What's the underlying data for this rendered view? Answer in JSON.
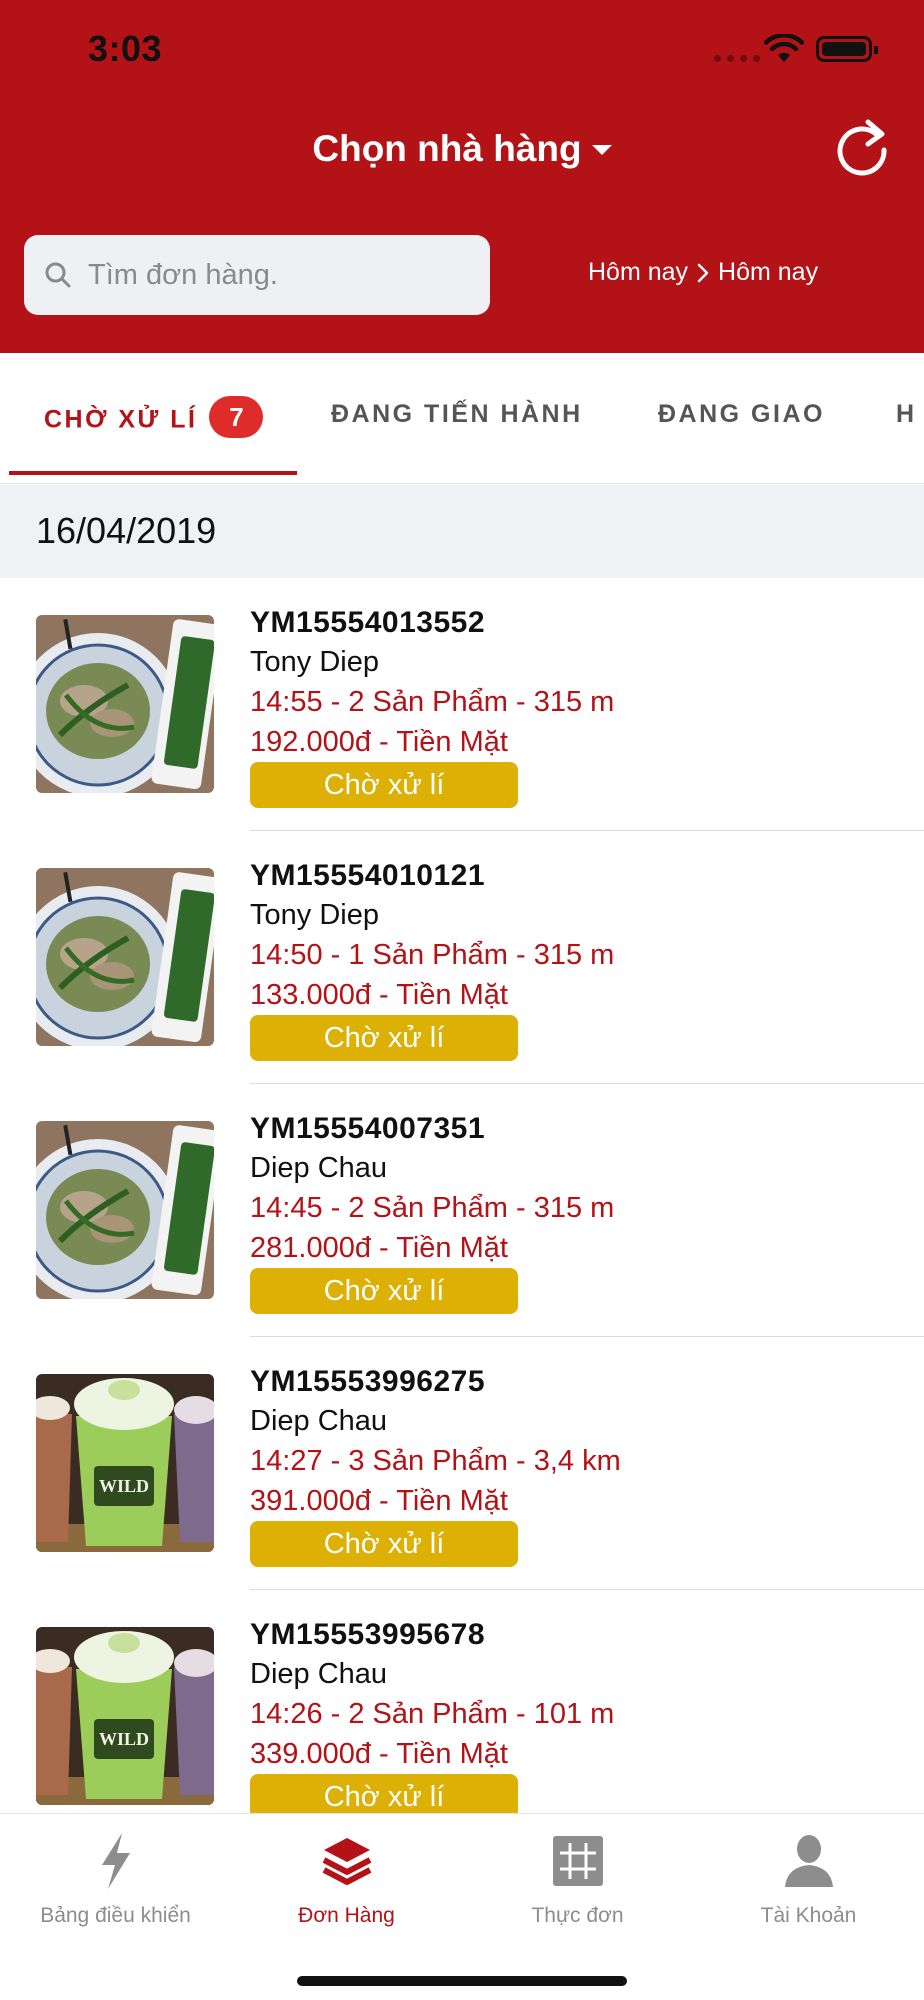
{
  "status_bar": {
    "time": "3:03"
  },
  "header": {
    "title": "Chọn nhà hàng",
    "search_placeholder": "Tìm đơn hàng.",
    "date_from": "Hôm nay",
    "date_to": "Hôm nay",
    "background_color": "#b31217"
  },
  "tabs": [
    {
      "label": "CHỜ XỬ LÍ",
      "badge": "7",
      "active": true
    },
    {
      "label": "ĐANG TIẾN HÀNH",
      "active": false
    },
    {
      "label": "ĐANG GIAO",
      "active": false
    },
    {
      "label": "H",
      "active": false
    }
  ],
  "date_group": "16/04/2019",
  "orders": [
    {
      "id": "YM15554013552",
      "customer": "Tony Diep",
      "line1": "14:55 - 2 Sản Phẩm - 315 m",
      "line2": "192.000đ - Tiền Mặt",
      "status": "Chờ xử lí",
      "image": "vegetable-dish"
    },
    {
      "id": "YM15554010121",
      "customer": "Tony Diep",
      "line1": "14:50 - 1 Sản Phẩm - 315 m",
      "line2": "133.000đ - Tiền Mặt",
      "status": "Chờ xử lí",
      "image": "vegetable-dish"
    },
    {
      "id": "YM15554007351",
      "customer": "Diep Chau",
      "line1": "14:45 - 2 Sản Phẩm - 315 m",
      "line2": "281.000đ - Tiền Mặt",
      "status": "Chờ xử lí",
      "image": "vegetable-dish"
    },
    {
      "id": "YM15553996275",
      "customer": "Diep Chau",
      "line1": "14:27 - 3 Sản Phẩm - 3,4 km",
      "line2": "391.000đ - Tiền Mặt",
      "status": "Chờ xử lí",
      "image": "drinks"
    },
    {
      "id": "YM15553995678",
      "customer": "Diep Chau",
      "line1": "14:26 - 2 Sản Phẩm - 101 m",
      "line2": "339.000đ - Tiền Mặt",
      "status": "Chờ xử lí",
      "image": "drinks"
    }
  ],
  "status_color": "#dcb005",
  "bottom_nav": [
    {
      "label": "Bảng điều khiển",
      "icon": "lightning-icon",
      "active": false
    },
    {
      "label": "Đơn Hàng",
      "icon": "layers-icon",
      "active": true
    },
    {
      "label": "Thực đơn",
      "icon": "grid-icon",
      "active": false
    },
    {
      "label": "Tài Khoản",
      "icon": "user-icon",
      "active": false
    }
  ]
}
